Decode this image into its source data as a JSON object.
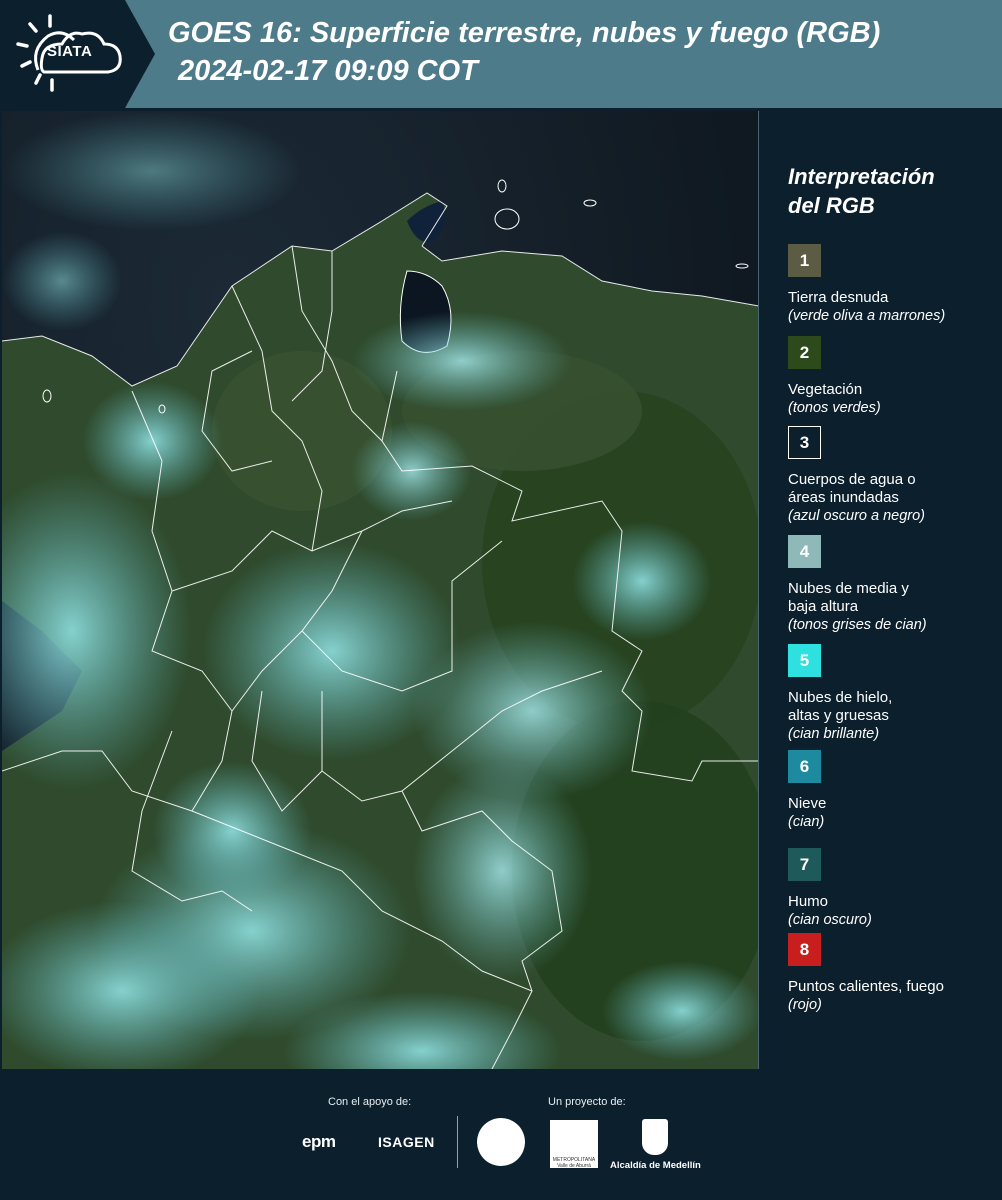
{
  "header": {
    "logo_text": "SIATA",
    "title_line1": "GOES 16: Superficie terrestre, nubes y fuego (RGB)",
    "title_line2": "2024-02-17 09:09 COT",
    "background_color": "#4d7b8a",
    "logo_background_color": "#0c1f2c"
  },
  "map": {
    "description_icon": "satellite-rgb-map"
  },
  "legend": {
    "title_line1": "Interpretación",
    "title_line2": "del RGB",
    "items": [
      {
        "number": "1",
        "label": "Tierra desnuda",
        "note": "(verde oliva a marrones)",
        "color": "#5c5c44",
        "text_color": "#ffffff"
      },
      {
        "number": "2",
        "label": "Vegetación",
        "note": "(tonos verdes)",
        "color": "#2c4a1c",
        "text_color": "#ffffff"
      },
      {
        "number": "3",
        "label": "Cuerpos de agua o áreas inundadas",
        "note": "(azul oscuro a negro)",
        "color": "#0c1f2c",
        "text_color": "#ffffff"
      },
      {
        "number": "4",
        "label": "Nubes de media y baja altura",
        "note": "(tonos grises de cian)",
        "color": "#8fb8b8",
        "text_color": "#ffffff"
      },
      {
        "number": "5",
        "label": "Nubes de hielo, altas y gruesas",
        "note": "(cian brillante)",
        "color": "#2ee0e0",
        "text_color": "#ffffff"
      },
      {
        "number": "6",
        "label": "Nieve",
        "note": "(cian)",
        "color": "#1e8aa0",
        "text_color": "#ffffff"
      },
      {
        "number": "7",
        "label": "Humo",
        "note": "(cian oscuro)",
        "color": "#1f5a5a",
        "text_color": "#ffffff"
      },
      {
        "number": "8",
        "label": "Puntos calientes, fuego",
        "note": "(rojo)",
        "color": "#c81e1e",
        "text_color": "#ffffff"
      }
    ]
  },
  "footer": {
    "support_label": "Con el apoyo de:",
    "project_label": "Un proyecto de:",
    "epm": "epm",
    "isagen": "ISAGEN",
    "amva_text": "METROPOLITANA Valle de Aburrá",
    "medellin": "Alcaldía de Medellín"
  }
}
